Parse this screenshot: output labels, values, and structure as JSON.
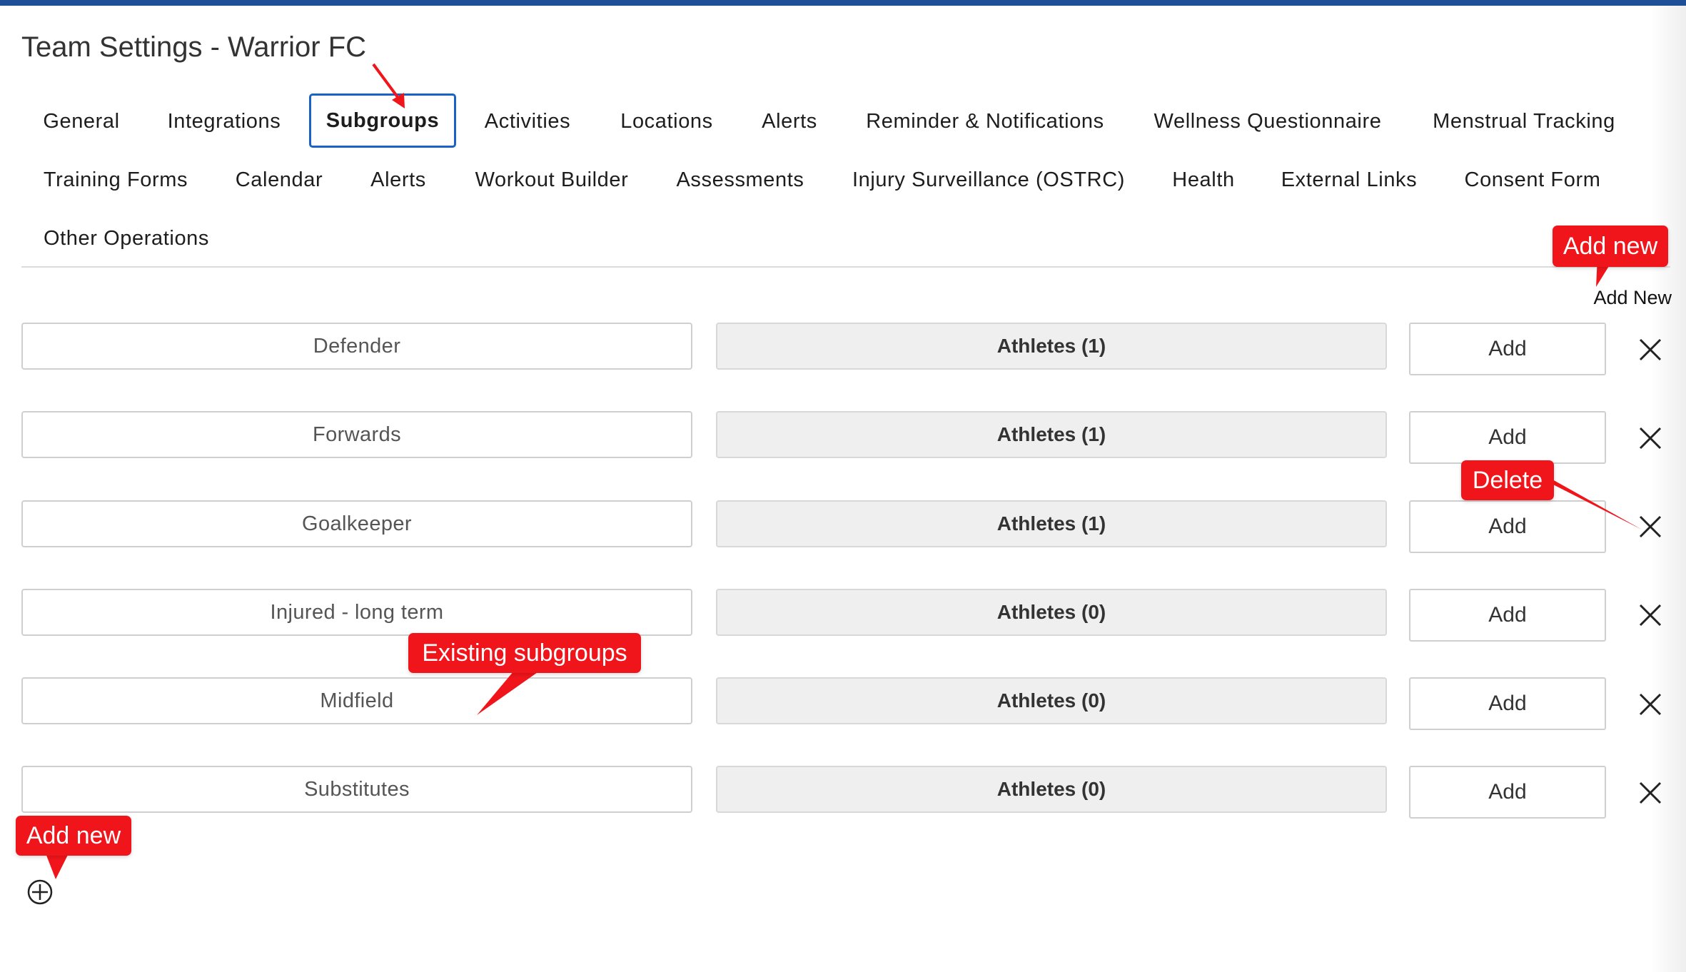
{
  "page_title": "Team Settings - Warrior FC",
  "colors": {
    "top_bar": "#1f4f96",
    "active_tab_border": "#1a62c7",
    "callout_bg": "#f0151b"
  },
  "tabs_row1": [
    {
      "label": "General"
    },
    {
      "label": "Integrations"
    },
    {
      "label": "Subgroups",
      "active": true
    },
    {
      "label": "Activities"
    },
    {
      "label": "Locations"
    },
    {
      "label": "Alerts"
    },
    {
      "label": "Reminder & Notifications"
    },
    {
      "label": "Wellness Questionnaire"
    },
    {
      "label": "Menstrual Tracking"
    }
  ],
  "tabs_row2": [
    {
      "label": "Training Forms"
    },
    {
      "label": "Calendar"
    },
    {
      "label": "Alerts"
    },
    {
      "label": "Workout Builder"
    },
    {
      "label": "Assessments"
    },
    {
      "label": "Injury Surveillance (OSTRC)"
    },
    {
      "label": "Health"
    },
    {
      "label": "External Links"
    },
    {
      "label": "Consent Form"
    }
  ],
  "tabs_row3": [
    {
      "label": "Other Operations"
    }
  ],
  "add_new_link": "Add New",
  "subgroups": [
    {
      "name": "Defender",
      "athletes": "Athletes (1)",
      "add_label": "Add"
    },
    {
      "name": "Forwards",
      "athletes": "Athletes (1)",
      "add_label": "Add"
    },
    {
      "name": "Goalkeeper",
      "athletes": "Athletes (1)",
      "add_label": "Add"
    },
    {
      "name": "Injured - long term",
      "athletes": "Athletes (0)",
      "add_label": "Add"
    },
    {
      "name": "Midfield",
      "athletes": "Athletes (0)",
      "add_label": "Add"
    },
    {
      "name": "Substitutes",
      "athletes": "Athletes (0)",
      "add_label": "Add"
    }
  ],
  "icons": {
    "delete": "close-icon",
    "add_subgroup": "plus-circle-icon"
  },
  "callouts": {
    "add_new_top": "Add new",
    "delete": "Delete",
    "existing": "Existing subgroups",
    "add_new_bottom": "Add new"
  }
}
